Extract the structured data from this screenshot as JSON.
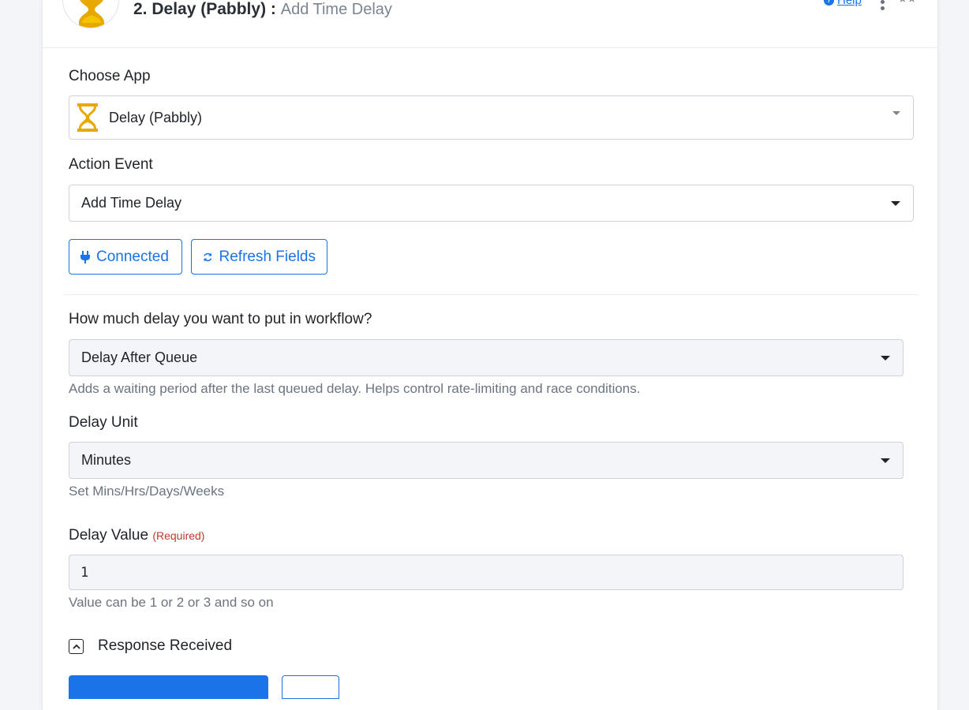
{
  "header": {
    "step_title": "2. Delay (Pabbly) :",
    "step_subtitle": "Add Time Delay",
    "help_link": "Help"
  },
  "choose_app": {
    "label": "Choose App",
    "value": "Delay (Pabbly)",
    "icon": "hourglass-icon"
  },
  "action_event": {
    "label": "Action Event",
    "value": "Add Time Delay"
  },
  "buttons": {
    "connected": "Connected",
    "refresh": "Refresh Fields"
  },
  "delay_type": {
    "label": "How much delay you want to put in workflow?",
    "value": "Delay After Queue",
    "help": "Adds a waiting period after the last queued delay. Helps control rate-limiting and race conditions."
  },
  "delay_unit": {
    "label": "Delay Unit",
    "value": "Minutes",
    "help": "Set Mins/Hrs/Days/Weeks"
  },
  "delay_value": {
    "label": "Delay Value",
    "required": "(Required)",
    "value": "1",
    "help": "Value can be 1 or 2 or 3 and so on"
  },
  "response": {
    "label": "Response Received"
  },
  "colors": {
    "accent": "#1a73e8",
    "app_icon": "#e8a800",
    "required": "#c0392b"
  }
}
